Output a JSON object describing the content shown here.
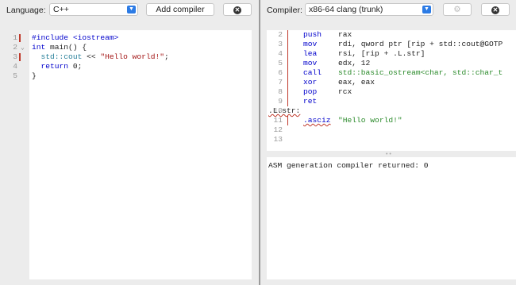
{
  "left": {
    "language_label": "Language:",
    "language_value": "C++",
    "add_compiler_label": "Add compiler",
    "source_lines": [
      {
        "n": "1",
        "parts": [
          {
            "t": "#include <iostream>",
            "c": "kw"
          }
        ]
      },
      {
        "n": "2",
        "parts": [
          {
            "t": "int ",
            "c": "kw"
          },
          {
            "t": "main() {",
            "c": ""
          }
        ]
      },
      {
        "n": "3",
        "parts": [
          {
            "t": "  std::cout",
            "c": "ns"
          },
          {
            "t": " << ",
            "c": ""
          },
          {
            "t": "\"Hello world!\"",
            "c": "str"
          },
          {
            "t": ";",
            "c": ""
          }
        ]
      },
      {
        "n": "4",
        "parts": [
          {
            "t": "  return ",
            "c": "kw"
          },
          {
            "t": "0;",
            "c": ""
          }
        ]
      },
      {
        "n": "5",
        "parts": [
          {
            "t": "}",
            "c": ""
          }
        ]
      }
    ]
  },
  "right": {
    "compiler_label": "Compiler:",
    "compiler_value": "x86-64 clang (trunk)",
    "asm_lines": [
      {
        "n": "2",
        "mn": "push",
        "op": "rax"
      },
      {
        "n": "3",
        "mn": "mov",
        "op": "rdi, qword ptr [rip + std::cout@GOTP"
      },
      {
        "n": "4",
        "mn": "lea",
        "op": "rsi, [rip + .L.str]"
      },
      {
        "n": "5",
        "mn": "mov",
        "op": "edx, 12"
      },
      {
        "n": "6",
        "mn": "call",
        "op": "std::basic_ostream<char, std::char_t"
      },
      {
        "n": "7",
        "mn": "xor",
        "op": "eax, eax"
      },
      {
        "n": "8",
        "mn": "pop",
        "op": "rcx"
      },
      {
        "n": "9",
        "mn": "ret",
        "op": ""
      },
      {
        "n": "10",
        "label": ".L.str:"
      },
      {
        "n": "11",
        "mn": ".asciz",
        "op": "\"Hello world!\""
      },
      {
        "n": "12"
      },
      {
        "n": "13"
      }
    ],
    "output_text": "ASM generation compiler returned: 0"
  }
}
